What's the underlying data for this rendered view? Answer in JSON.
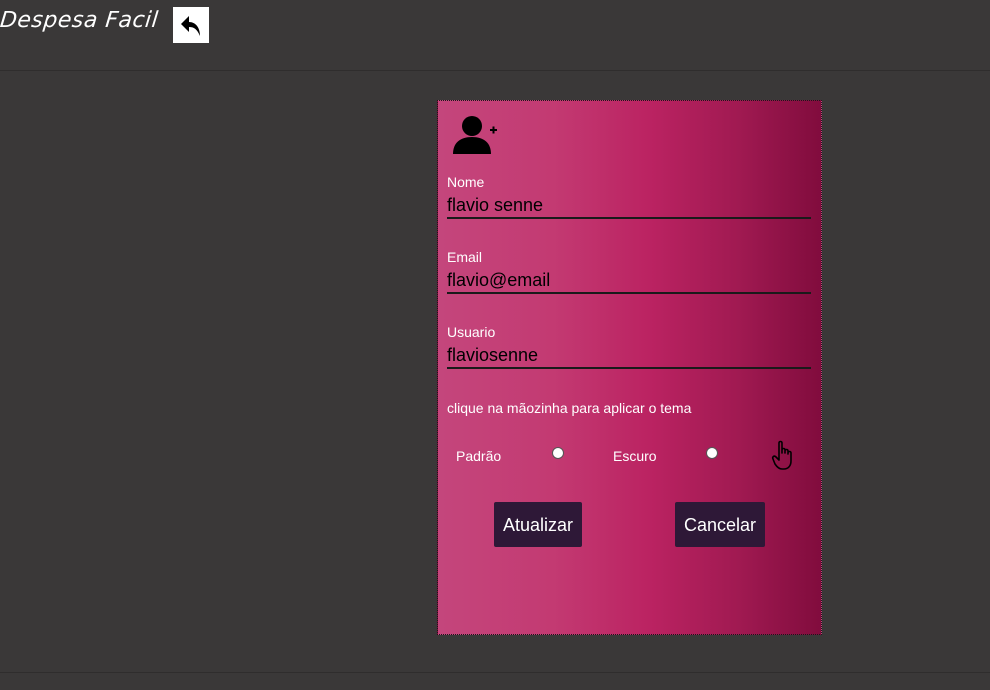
{
  "header": {
    "app_title": "Despesa Facil",
    "back_icon": "reply-arrow-icon"
  },
  "form": {
    "icon": "user-plus-icon",
    "fields": [
      {
        "label": "Nome",
        "value": "flavio senne"
      },
      {
        "label": "Email",
        "value": "flavio@email"
      },
      {
        "label": "Usuario",
        "value": "flaviosenne"
      }
    ],
    "theme_hint": "clique na mãozinha para aplicar o tema",
    "themes": [
      {
        "label": "Padrão",
        "selected": false
      },
      {
        "label": "Escuro",
        "selected": false
      }
    ],
    "apply_icon": "pointing-hand-icon",
    "update_label": "Atualizar",
    "cancel_label": "Cancelar"
  },
  "colors": {
    "background": "#3a3838",
    "card_gradient_start": "#c4467c",
    "card_gradient_end": "#810c3d",
    "button_bg": "#2e1837"
  }
}
